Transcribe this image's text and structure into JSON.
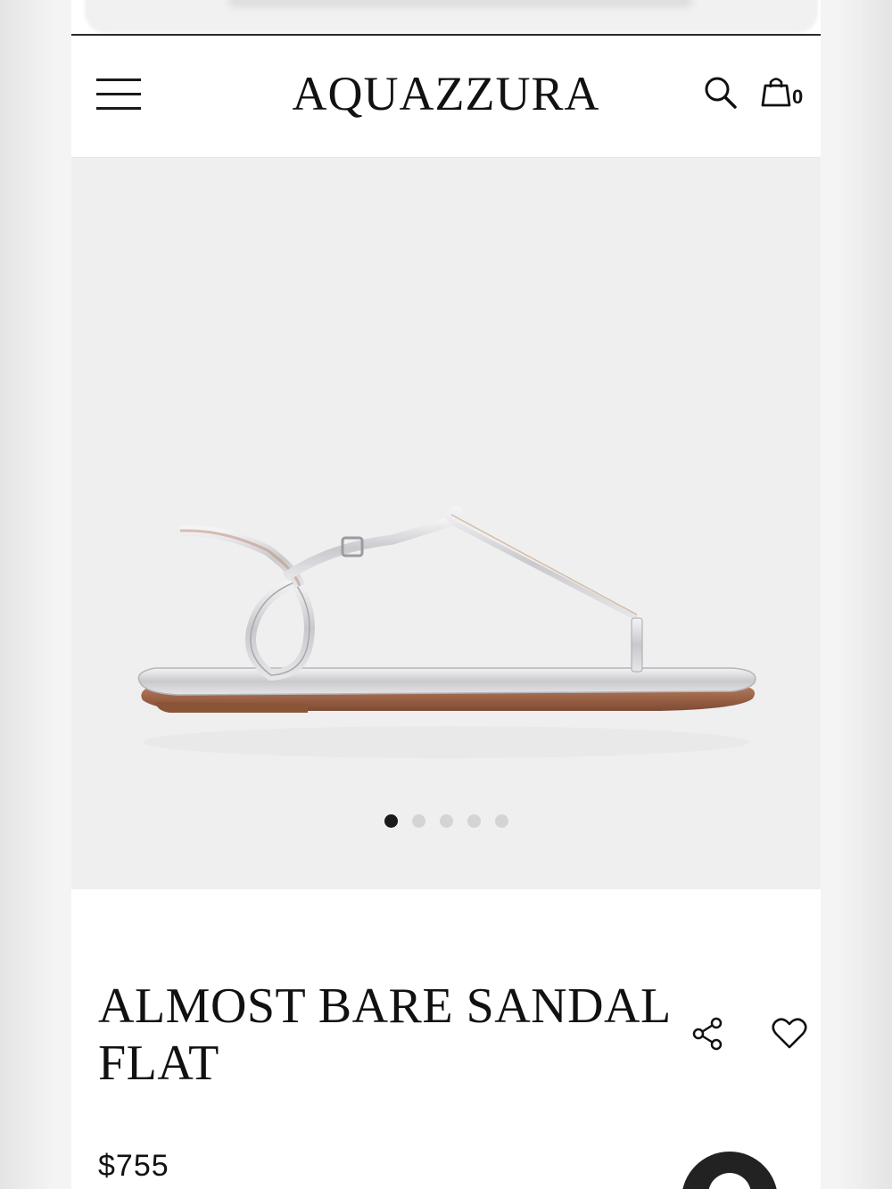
{
  "brand": {
    "logo_text": "AQUAZZURA"
  },
  "header": {
    "cart_count": "0",
    "icons": [
      "menu-icon",
      "search-icon",
      "shopping-bag-icon"
    ]
  },
  "gallery": {
    "image_subject": "sandal-image",
    "slide_count": 5,
    "active_slide": 1
  },
  "product": {
    "title_line1": "ALMOST BARE SANDAL",
    "title_line2": "FLAT",
    "price": "$755",
    "actions": [
      "share-icon",
      "heart-icon"
    ]
  },
  "colors": {
    "text": "#111111",
    "gallery_bg": "#efefef",
    "dot_active": "#1a1a1a",
    "dot_inactive": "#d4d4d4"
  }
}
